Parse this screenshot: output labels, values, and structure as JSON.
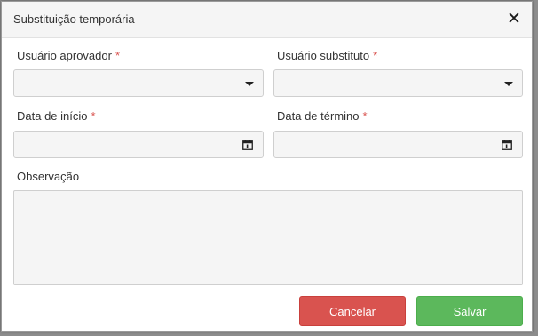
{
  "modal": {
    "title": "Substituição temporária",
    "close_symbol": "✕"
  },
  "form": {
    "required_mark": "*",
    "approver_label": "Usuário aprovador",
    "substitute_label": "Usuário substituto",
    "start_date_label": "Data de início",
    "end_date_label": "Data de término",
    "observation_label": "Observação"
  },
  "buttons": {
    "cancel_label": "Cancelar",
    "save_label": "Salvar"
  },
  "colors": {
    "required": "#d9534f",
    "cancel": "#d9534f",
    "save": "#5cb85c"
  },
  "icons": {
    "close": "close-icon",
    "dropdown": "chevron-down-icon",
    "calendar": "calendar-icon"
  }
}
